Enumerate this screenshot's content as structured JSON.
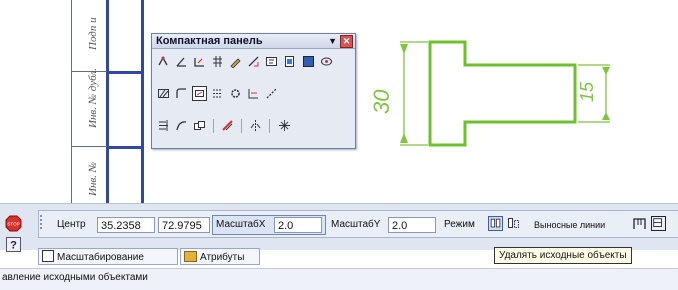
{
  "frame": {
    "vertical_labels": [
      "Подп и",
      "Инв. № дубл.",
      "Инв. №"
    ]
  },
  "compact_panel": {
    "title": "Компактная панель",
    "menu_glyph": "▼",
    "close_glyph": "✕",
    "toolbar_row1": [
      "snap-icon",
      "angle-icon",
      "align-icon",
      "grid-icon",
      "pen-icon",
      "measure-icon",
      "text-icon",
      "doc-icon",
      "sheet-icon",
      "layers-icon"
    ],
    "toolbar_row2": [
      "hatch-icon",
      "fillet-icon",
      "rectangle-icon",
      "array-icon",
      "gear-icon",
      "dimension-icon",
      "line-icon"
    ],
    "toolbar_row3": [
      "trim-icon",
      "curve-icon",
      "copy-icon",
      "delete-icon",
      "mirror-icon",
      "scale-icon"
    ]
  },
  "drawing": {
    "dim_left": "30",
    "dim_right": "15",
    "line_color": "#6cc22a",
    "dim_color": "#7cc83a"
  },
  "property_bar": {
    "center_label": "Центр",
    "center_x": "35.2358",
    "center_y": "72.9795",
    "scale_x_label": "МасштабХ",
    "scale_x_value": "2.0",
    "scale_y_label": "МасштабY",
    "scale_y_value": "2.0",
    "mode_label": "Режим",
    "leader_lines_label": "Выносные линии",
    "stop_label": "STOP"
  },
  "tabs": [
    {
      "label": "Масштабирование"
    },
    {
      "label": "Атрибуты"
    }
  ],
  "tooltip": "Удалять исходные объекты",
  "status": "авление исходными объектами"
}
